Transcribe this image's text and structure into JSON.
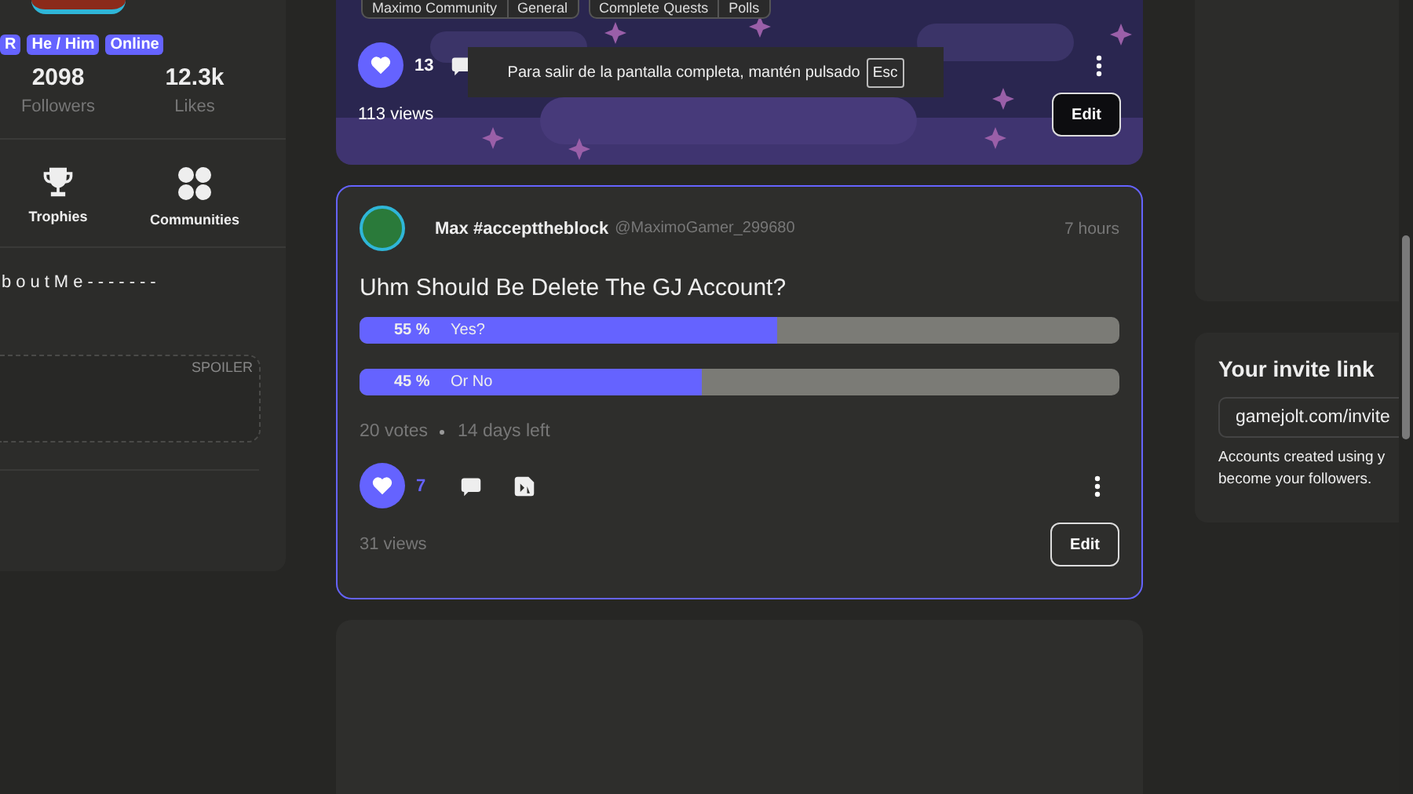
{
  "profile": {
    "badges": [
      {
        "label": "R"
      },
      {
        "label": "He / Him"
      },
      {
        "label": "Online"
      }
    ],
    "stats": [
      {
        "value": "2098",
        "label": "Followers"
      },
      {
        "value": "12.3k",
        "label": "Likes"
      }
    ],
    "links": [
      {
        "label": "Trophies",
        "kind": "trophy"
      },
      {
        "label": "Communities",
        "kind": "communities"
      }
    ],
    "about": "boutMe-------",
    "spoiler": "SPOILER"
  },
  "posts": [
    {
      "kind": "banner",
      "communities": [
        {
          "name": "Maximo Community",
          "channel": "General"
        },
        {
          "name": "Complete Quests",
          "channel": "Polls"
        }
      ],
      "likes": "13",
      "liked": true,
      "views": "113 views",
      "edit": "Edit"
    },
    {
      "kind": "poll",
      "author": "Max #accepttheblock",
      "handle": "@MaximoGamer_299680",
      "time": "7 hours",
      "question": "Uhm Should Be Delete The GJ Account?",
      "options": [
        {
          "percent": "55 %",
          "label": "Yes?",
          "level": 0.55
        },
        {
          "percent": "45 %",
          "label": "Or No",
          "level": 0.45
        }
      ],
      "votes": "20 votes",
      "remaining": "14 days left",
      "likes": "7",
      "liked": true,
      "views": "31 views",
      "edit": "Edit"
    }
  ],
  "fullscreen_notice": {
    "text": "Para salir de la pantalla completa, mantén pulsado",
    "key": "Esc"
  },
  "invite": {
    "title": "Your invite link",
    "link": "gamejolt.com/invite",
    "note": [
      "Accounts created using y",
      "become your followers."
    ]
  }
}
